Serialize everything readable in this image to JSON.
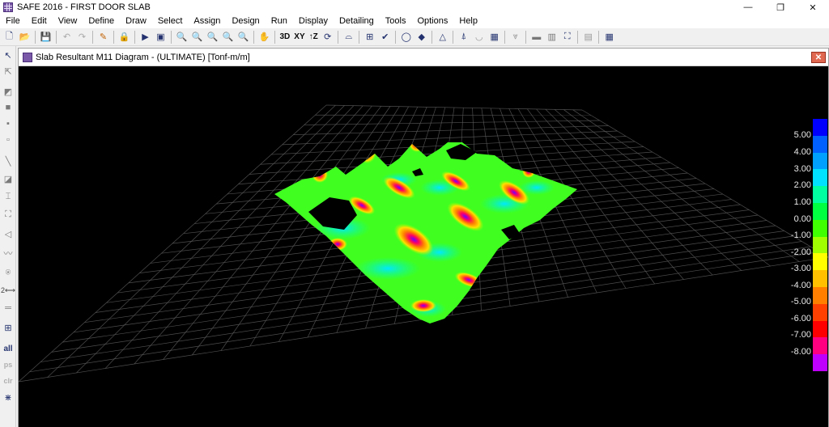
{
  "window": {
    "title": "SAFE 2016 - FIRST DOOR SLAB",
    "minimize": "—",
    "restore": "❐",
    "close": "✕"
  },
  "menu": [
    "File",
    "Edit",
    "View",
    "Define",
    "Draw",
    "Select",
    "Assign",
    "Design",
    "Run",
    "Display",
    "Detailing",
    "Tools",
    "Options",
    "Help"
  ],
  "toolbar": {
    "view_3d": "3D",
    "view_xy": "XY",
    "view_xz": "↑Z"
  },
  "lefttools": {
    "all": "all",
    "ps": "ps",
    "clr": "clr"
  },
  "view": {
    "title": "Slab Resultant M11 Diagram - (ULTIMATE)  [Tonf-m/m]",
    "close": "✕"
  },
  "legend": {
    "labels": [
      "5.00",
      "4.00",
      "3.00",
      "2.00",
      "1.00",
      "0.00",
      "-1.00",
      "-2.00",
      "-3.00",
      "-4.00",
      "-5.00",
      "-6.00",
      "-7.00",
      "-8.00"
    ],
    "colors": [
      "#0000ff",
      "#0060ff",
      "#00a0ff",
      "#00e0ff",
      "#00ffa0",
      "#00ff40",
      "#40ff00",
      "#a0ff00",
      "#ffff00",
      "#ffc000",
      "#ff8000",
      "#ff4000",
      "#ff0000",
      "#ff0080",
      "#c000ff"
    ]
  },
  "colors": {
    "background": "#000000",
    "grid": "#5a5a5a"
  }
}
